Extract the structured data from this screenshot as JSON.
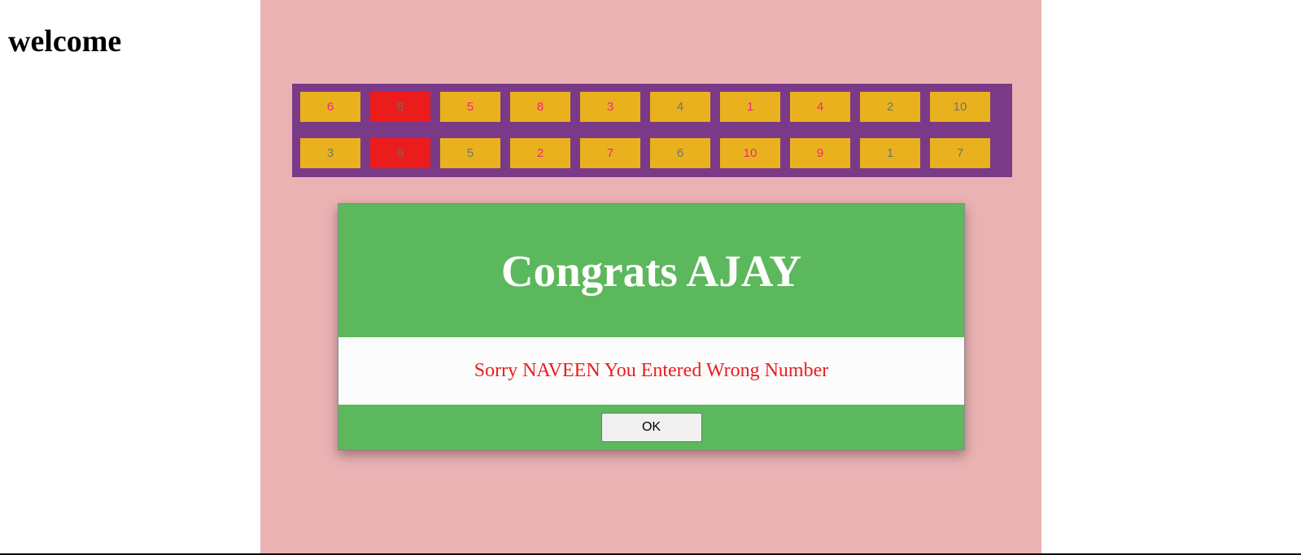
{
  "page": {
    "heading": "welcome"
  },
  "colors": {
    "panel_background": "#ebb2b3",
    "grid_background": "#7b3a87",
    "tile_background": "#eab11f",
    "tile_selected_background": "#ec1c1d",
    "tile_text_pink": "#f0287a",
    "tile_text_grey": "#6e7762",
    "dialog_background": "#5cb85c",
    "dialog_body_background": "#fcfcfc",
    "message_text": "#ec1c1d"
  },
  "grid": {
    "rows": [
      [
        {
          "label": "6",
          "tone": "pink",
          "selected": false
        },
        {
          "label": "8",
          "tone": "grey",
          "selected": true
        },
        {
          "label": "5",
          "tone": "pink",
          "selected": false
        },
        {
          "label": "8",
          "tone": "pink",
          "selected": false
        },
        {
          "label": "3",
          "tone": "pink",
          "selected": false
        },
        {
          "label": "4",
          "tone": "grey",
          "selected": false
        },
        {
          "label": "1",
          "tone": "pink",
          "selected": false
        },
        {
          "label": "4",
          "tone": "pink",
          "selected": false
        },
        {
          "label": "2",
          "tone": "grey",
          "selected": false
        },
        {
          "label": "10",
          "tone": "grey",
          "selected": false
        }
      ],
      [
        {
          "label": "3",
          "tone": "grey",
          "selected": false
        },
        {
          "label": "9",
          "tone": "grey",
          "selected": true
        },
        {
          "label": "5",
          "tone": "grey",
          "selected": false
        },
        {
          "label": "2",
          "tone": "pink",
          "selected": false
        },
        {
          "label": "7",
          "tone": "pink",
          "selected": false
        },
        {
          "label": "6",
          "tone": "grey",
          "selected": false
        },
        {
          "label": "10",
          "tone": "pink",
          "selected": false
        },
        {
          "label": "9",
          "tone": "pink",
          "selected": false
        },
        {
          "label": "1",
          "tone": "grey",
          "selected": false
        },
        {
          "label": "7",
          "tone": "grey",
          "selected": false
        }
      ]
    ]
  },
  "dialog": {
    "title": "Congrats AJAY",
    "message": "Sorry NAVEEN You Entered Wrong Number",
    "ok_label": "OK"
  }
}
